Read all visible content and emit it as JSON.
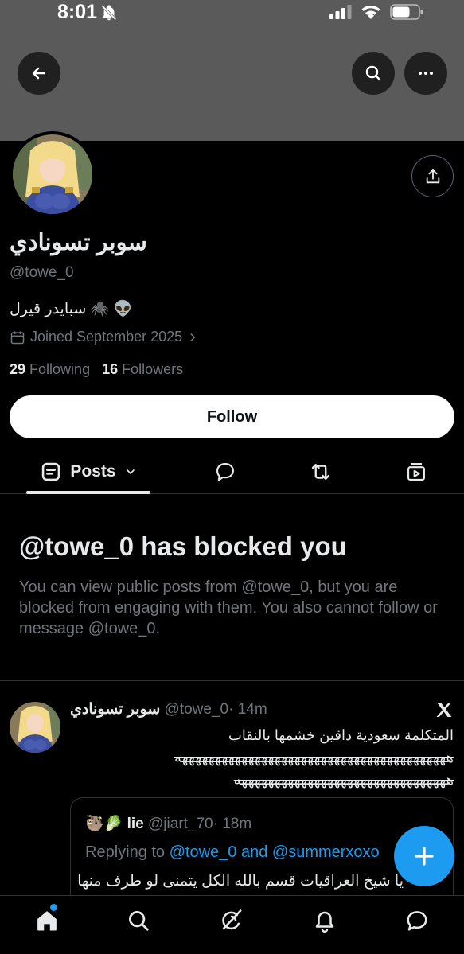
{
  "status_bar": {
    "time": "8:01",
    "icons": [
      "bell-off-icon",
      "signal-icon",
      "wifi-icon",
      "battery-icon"
    ]
  },
  "header": {
    "back_icon": "arrow-left-icon",
    "search_icon": "search-icon",
    "more_icon": "more-horizontal-icon",
    "banner_color": "#5a5a5a"
  },
  "profile": {
    "display_name": "سوبر تسونادي",
    "handle": "@towe_0",
    "bio": "سبايدر قيرل 🕷️ 👽",
    "joined": "Joined September 2025",
    "following_count": "29",
    "following_label": "Following",
    "followers_count": "16",
    "followers_label": "Followers",
    "follow_button": "Follow"
  },
  "tabs": {
    "active_label": "Posts",
    "items": [
      "posts-icon",
      "reply-icon",
      "repost-icon",
      "media-icon"
    ]
  },
  "blocked": {
    "title": "@towe_0 has blocked you",
    "body": "You can view public posts from @towe_0, but you are blocked from engaging with them. You also cannot follow or message @towe_0."
  },
  "post": {
    "name": "سوبر تسونادي",
    "handle": "@towe_0",
    "time": "· 14m",
    "line1": "المتكلمة سعودية داقين خشمها بالنقاب",
    "line2": "هههههههههههههههههههههههههههههههههههههههههه",
    "line3": "ههههههههههههههههههههههههههههههههه",
    "quote": {
      "emoji": "🦥🥬",
      "name": "lie",
      "handle": "@jiart_70",
      "time": "· 18m",
      "replying_prefix": "Replying to",
      "replying_targets": "@towe_0 and @summerxoxo",
      "text": "يا شيخ العراقيات قسم بالله الكل يتمنى لو طرف منها"
    }
  },
  "bottom_nav": [
    "home-icon",
    "search-icon",
    "grok-icon",
    "notifications-icon",
    "messages-icon"
  ],
  "colors": {
    "accent": "#1d9bf0",
    "muted": "#71767b",
    "text": "#e7e9ea",
    "border": "#2f3336"
  }
}
